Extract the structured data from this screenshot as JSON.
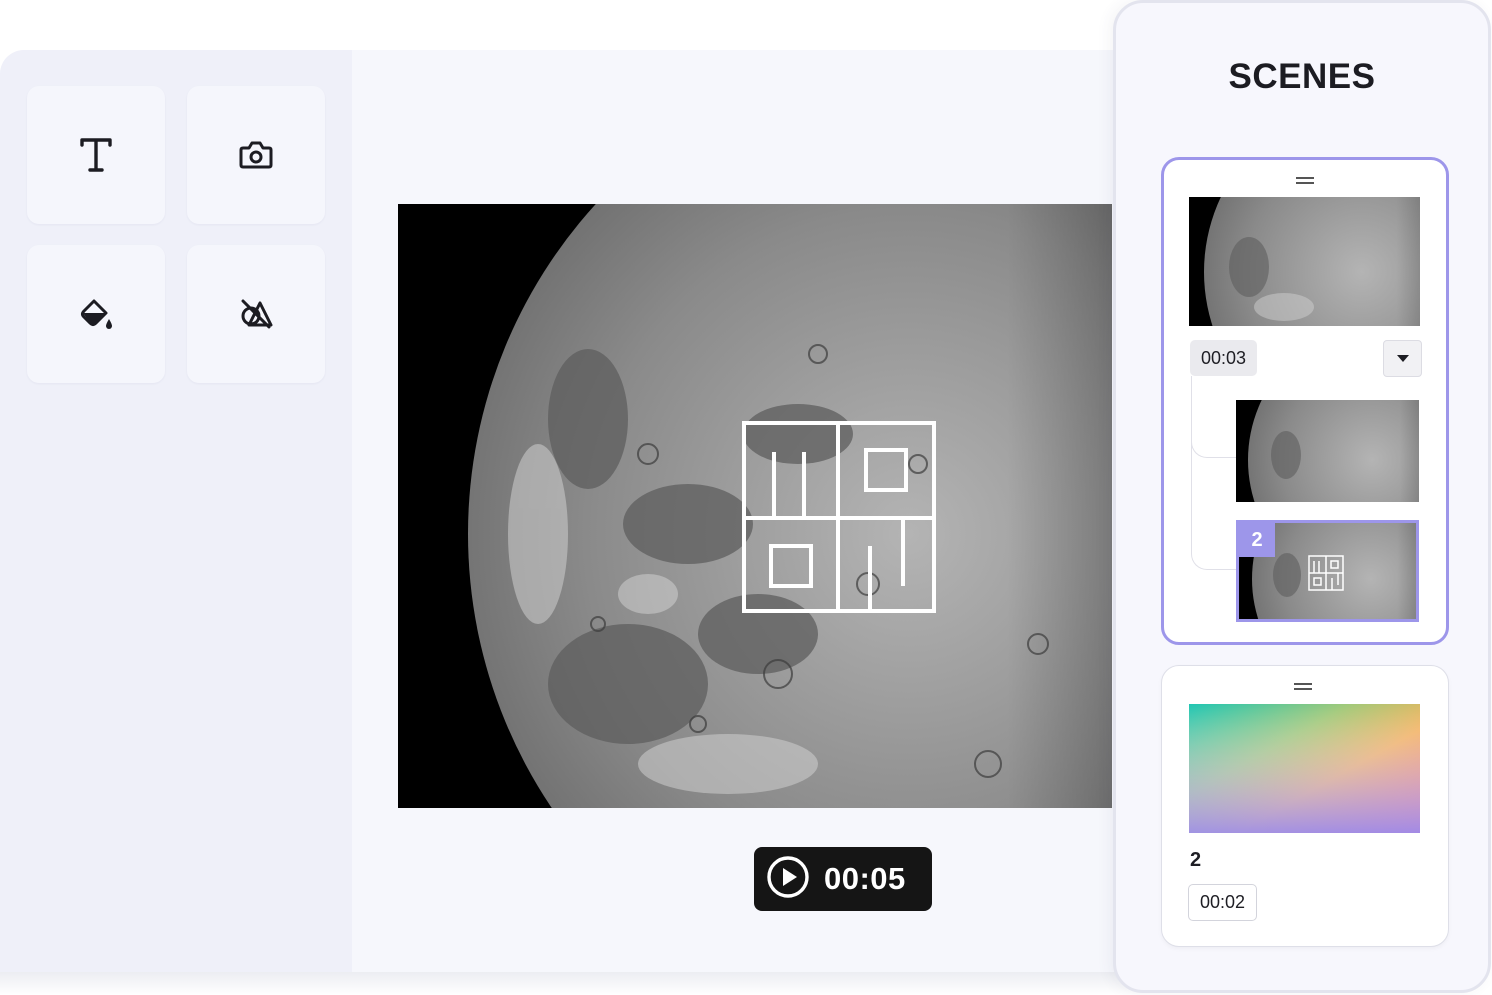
{
  "toolbar": {
    "tools": [
      {
        "name": "text-icon"
      },
      {
        "name": "camera-icon"
      },
      {
        "name": "paint-bucket-icon"
      },
      {
        "name": "shapes-icon"
      }
    ]
  },
  "player": {
    "time": "00:05",
    "icon": "play-icon"
  },
  "scenes_panel": {
    "title": "SCENES",
    "scenes": [
      {
        "duration": "00:03",
        "dropdown_icon": "caret-down-icon",
        "sub_items": [
          {
            "label": ""
          },
          {
            "label": "2"
          }
        ]
      },
      {
        "label": "2",
        "duration": "00:02"
      }
    ]
  },
  "colors": {
    "accent": "#9d96ea",
    "pill_bg": "#151515",
    "panel_bg": "#f7f7fd"
  }
}
